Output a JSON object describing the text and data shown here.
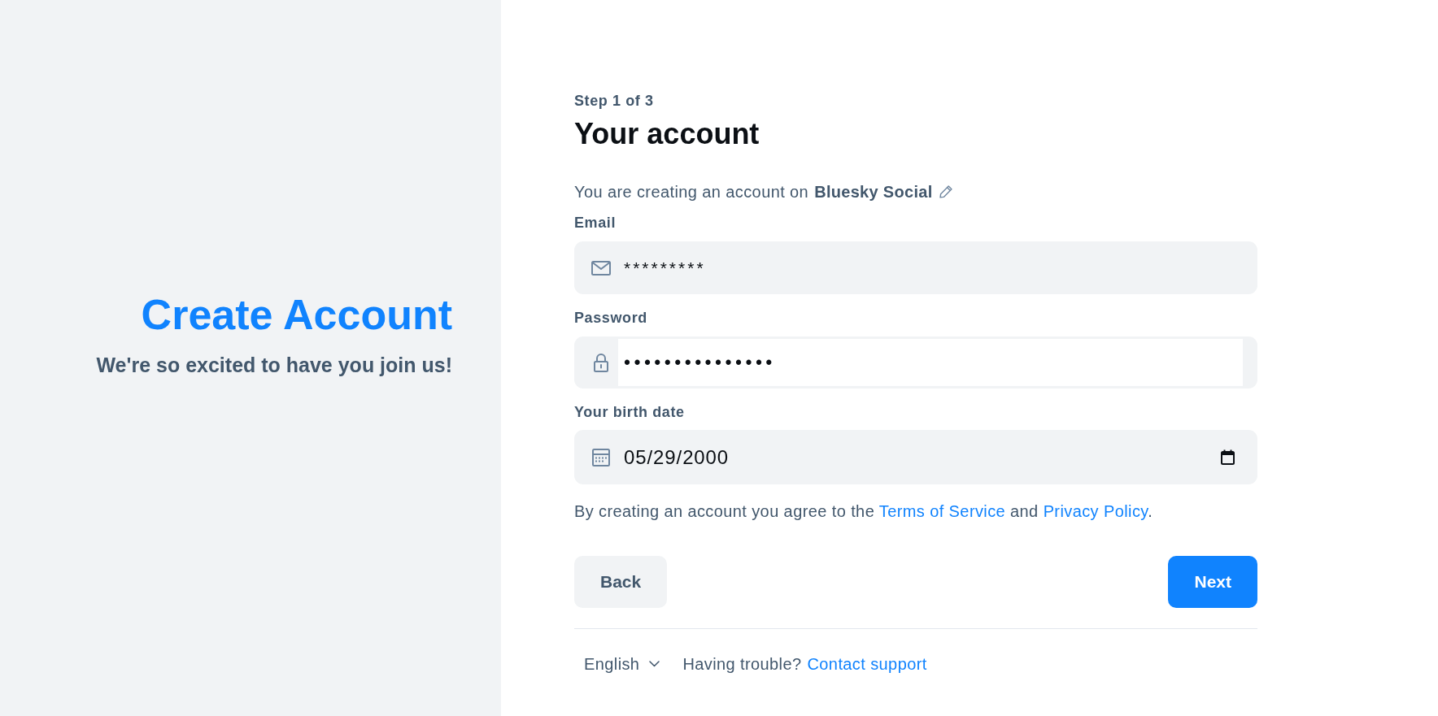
{
  "side_panel": {
    "title": "Create Account",
    "subtitle": "We're so excited to have you join us!"
  },
  "form": {
    "step": "Step 1 of 3",
    "title": "Your account",
    "provider_note": {
      "text": "You are creating an account on",
      "provider": "Bluesky Social"
    },
    "fields": [
      {
        "kind": "email",
        "label": "Email",
        "value": "*********",
        "highlighted": false
      },
      {
        "kind": "password",
        "label": "Password",
        "value": "•••••••••••••••",
        "highlighted": true
      },
      {
        "kind": "date",
        "label": "Your birth date",
        "value": "05/29/2000",
        "highlighted": false
      }
    ],
    "terms": {
      "before": "By creating an account you agree to the",
      "terms_link": "Terms of Service",
      "middle": "and",
      "privacy_link": "Privacy Policy",
      "after": "."
    },
    "buttons": [
      {
        "kind": "secondary",
        "label": "Back"
      },
      {
        "kind": "primary",
        "label": "Next"
      }
    ]
  },
  "footer": {
    "language": "English",
    "help_text": "Having trouble?",
    "help_link": "Contact support"
  }
}
